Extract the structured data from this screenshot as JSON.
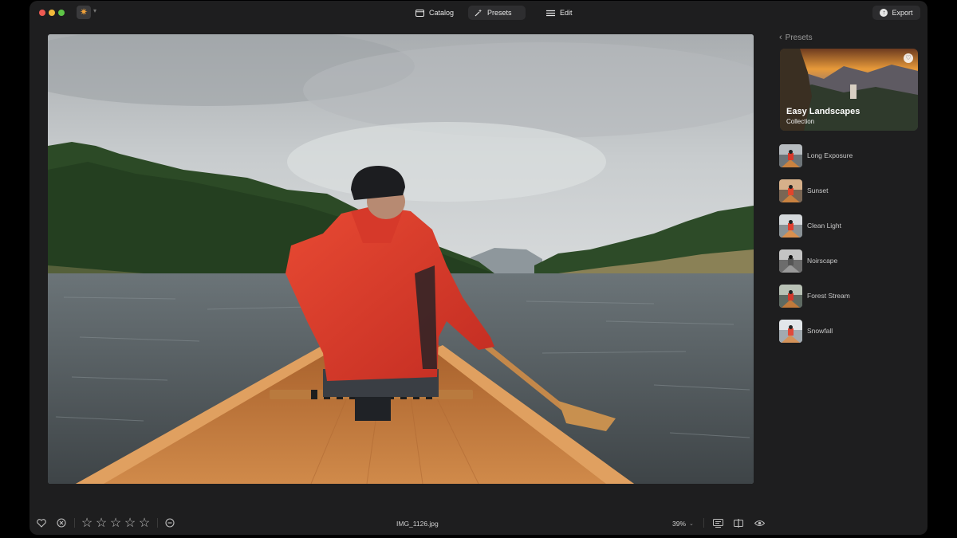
{
  "toolbar": {
    "catalog_label": "Catalog",
    "presets_label": "Presets",
    "edit_label": "Edit",
    "export_label": "Export"
  },
  "sidebar": {
    "back_label": "Presets",
    "collection": {
      "title": "Easy Landscapes",
      "subtitle": "Collection"
    },
    "presets": [
      {
        "label": "Long Exposure"
      },
      {
        "label": "Sunset"
      },
      {
        "label": "Clean Light"
      },
      {
        "label": "Noirscape"
      },
      {
        "label": "Forest Stream"
      },
      {
        "label": "Snowfall"
      }
    ]
  },
  "bottom": {
    "filename": "IMG_1126.jpg",
    "zoom": "39%",
    "rating_stars": 0
  },
  "colors": {
    "window_bg": "#1e1e1f",
    "accent": "#f0a23a",
    "jacket_red": "#d8382a",
    "canoe_wood": "#c27a3e"
  },
  "icons": [
    "app-icon",
    "catalog-icon",
    "presets-icon",
    "edit-icon",
    "export-icon",
    "heart-icon",
    "reject-icon",
    "star-icon",
    "minus-circle-icon",
    "compare-icon",
    "split-view-icon",
    "eye-icon"
  ]
}
